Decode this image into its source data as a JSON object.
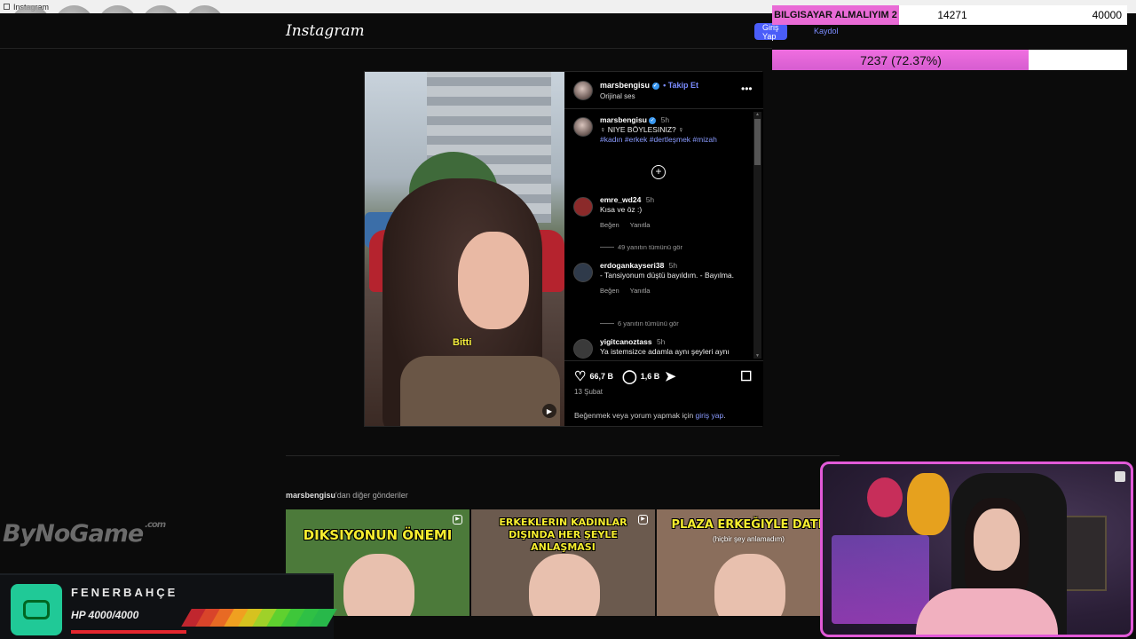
{
  "window": {
    "title": "Instagram"
  },
  "header": {
    "logo": "Instagram",
    "login_label": "Giriş Yap",
    "signup_label": "Kaydol"
  },
  "goal": {
    "label": "BILGISAYAR ALMALIYIM 2",
    "current": "14271",
    "target": "40000",
    "progress_text": "7237 (72.37%)",
    "progress_fraction": 0.7237,
    "accent_color": "#e96bd6"
  },
  "post": {
    "author": "marsbengisu",
    "follow_label": "• Takip Et",
    "audio": "Orijinal ses",
    "video_caption": "Bitti",
    "caption": {
      "name": "marsbengisu",
      "time": "5h",
      "text": "♀ NIYE BÖYLESINIZ? ♀",
      "tags": "#kadın #erkek #dertleşmek #mizah"
    },
    "comments": [
      {
        "name": "emre_wd24",
        "time": "5h",
        "text": "Kısa ve öz :)",
        "like": "Beğen",
        "reply": "Yanıtla",
        "replies": "49 yanıtın tümünü gör"
      },
      {
        "name": "erdogankayseri38",
        "time": "5h",
        "text": "- Tansiyonum düştü bayıldım. - Bayılma.",
        "like": "Beğen",
        "reply": "Yanıtla",
        "replies": "6 yanıtın tümünü gör"
      },
      {
        "name": "yigitcanoztass",
        "time": "5h",
        "text": "Ya istemsizce adamla aynı şeyleri aynı"
      }
    ],
    "likes": "66,7 B",
    "comments_count": "1,6 B",
    "date": "13 Şubat",
    "login_prompt_pre": "Beğenmek veya yorum yapmak için ",
    "login_prompt_link": "giriş yap",
    "login_prompt_post": "."
  },
  "more_posts": {
    "author": "marsbengisu",
    "suffix": "'dan diğer gönderiler",
    "items": [
      {
        "title": "DIKSIYONUN ÖNEMI",
        "subtitle": "",
        "bg": "#4c7a3a"
      },
      {
        "title": "ERKEKLERIN KADINLAR DIŞINDA HER ŞEYLE ANLAŞMASI",
        "subtitle": "",
        "bg": "#6b5a4e"
      },
      {
        "title": "PLAZA ERKEĞIYLE DATE",
        "subtitle": "(hiçbir şey anlamadım)",
        "bg": "#8a6e5c"
      }
    ]
  },
  "branding": {
    "name": "ByNoGame",
    "suffix": ".com"
  },
  "hp_widget": {
    "team": "FENERBAHÇE",
    "hp_text": "HP 4000/4000",
    "hp_fraction": 1.0
  },
  "icons": [
    "win-icon",
    "more-icon",
    "heart-icon",
    "comment-icon",
    "share-icon",
    "save-icon",
    "add-icon",
    "mute-icon",
    "reel-icon",
    "mascot-icon",
    "verified-icon"
  ]
}
